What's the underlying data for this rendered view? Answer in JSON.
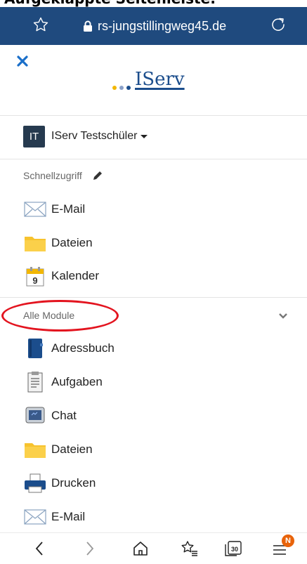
{
  "heading": "Aufgeklappte Seitenleiste:",
  "browser": {
    "url": "rs-jungstillingweg45.de",
    "tabs_count": "30",
    "menu_badge": "N"
  },
  "sidebar": {
    "logo_text": "IServ",
    "user": {
      "initials": "IT",
      "name": "IServ Testschüler"
    },
    "quick_access": {
      "label": "Schnellzugriff",
      "items": [
        {
          "label": "E-Mail",
          "icon": "mail-icon"
        },
        {
          "label": "Dateien",
          "icon": "folder-icon"
        },
        {
          "label": "Kalender",
          "icon": "calendar-icon",
          "calendar_day": "9"
        }
      ]
    },
    "all_modules": {
      "label": "Alle Module",
      "items": [
        {
          "label": "Adressbuch",
          "icon": "address-book-icon"
        },
        {
          "label": "Aufgaben",
          "icon": "tasks-icon"
        },
        {
          "label": "Chat",
          "icon": "chat-icon"
        },
        {
          "label": "Dateien",
          "icon": "folder-icon"
        },
        {
          "label": "Drucken",
          "icon": "printer-icon"
        },
        {
          "label": "E-Mail",
          "icon": "mail-icon"
        }
      ]
    }
  },
  "colors": {
    "browser_bar": "#1f4a7e",
    "accent_blue": "#1a6fc9",
    "annotation_red": "#e3141f",
    "badge_orange": "#e8630a",
    "folder_yellow": "#f7c32e"
  }
}
